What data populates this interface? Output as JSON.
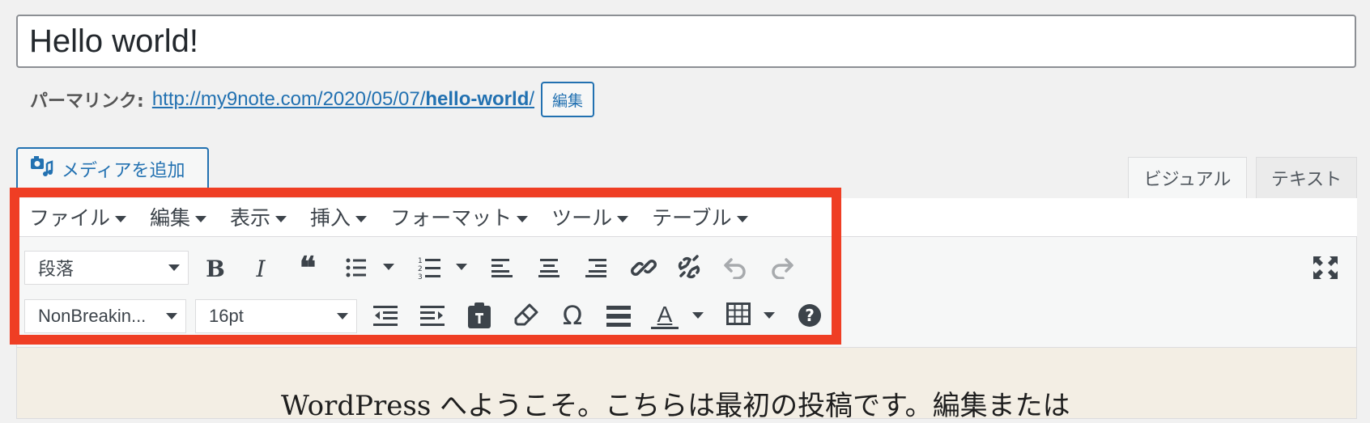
{
  "post": {
    "title": "Hello world!"
  },
  "permalink": {
    "label": "パーマリンク:",
    "url_prefix": "http://my9note.com/2020/05/07/",
    "url_slug": "hello-world",
    "url_suffix": "/",
    "edit_label": "編集"
  },
  "media": {
    "add_label": "メディアを追加",
    "icon": "add-media-icon"
  },
  "tabs": {
    "visual": "ビジュアル",
    "text": "テキスト"
  },
  "menubar": [
    "ファイル",
    "編集",
    "表示",
    "挿入",
    "フォーマット",
    "ツール",
    "テーブル"
  ],
  "toolbar": {
    "format_select": "段落",
    "font_family_select": "NonBreakin...",
    "font_size_select": "16pt",
    "row1_icons": [
      "bold-icon",
      "italic-icon",
      "blockquote-icon",
      "bullet-list-icon",
      "numbered-list-icon",
      "align-left-icon",
      "align-center-icon",
      "align-right-icon",
      "link-icon",
      "unlink-icon",
      "undo-icon",
      "redo-icon",
      "fullscreen-icon"
    ],
    "row2_icons": [
      "outdent-icon",
      "indent-icon",
      "paste-text-icon",
      "clear-formatting-icon",
      "special-character-icon",
      "horizontal-line-icon",
      "text-color-icon",
      "table-icon",
      "help-icon"
    ],
    "glyphs": {
      "bold": "B",
      "italic": "I",
      "quote": "❝",
      "omega": "Ω",
      "text_color": "A",
      "help": "?"
    }
  },
  "editor": {
    "content": "WordPress へようこそ。こちらは最初の投稿です。編集または"
  },
  "colors": {
    "accent": "#2271b1",
    "highlight": "#ef3e24",
    "content_bg": "#f3eee4"
  }
}
